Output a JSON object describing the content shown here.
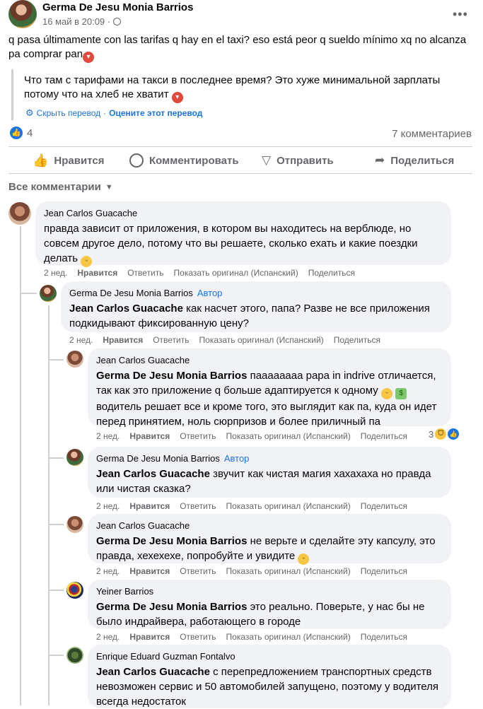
{
  "post": {
    "author": "Germa De Jesu Monia Barrios",
    "time": "16 май в 20:09 ·",
    "original_text": "q pasa últimamente con las tarifas q hay en el taxi? eso está peor q sueldo mínimo xq no alcanza pa comprar pan",
    "translated_text": "Что там с тарифами на такси в последнее время? Это хуже минимальной зарплаты потому что на хлеб не хватит",
    "hide_translation": "Скрыть перевод",
    "rate_translation": "Оцените этот перевод",
    "separator": "·",
    "reactions_count": "4",
    "comments_count": "7 комментариев"
  },
  "toolbar": {
    "like": "Нравится",
    "comment": "Комментировать",
    "send": "Отправить",
    "share": "Поделиться"
  },
  "comments_filter": "Все комментарии",
  "comments": [
    {
      "name": "Jean Carlos Guacache",
      "author_badge": "",
      "mention": "",
      "text": "правда зависит от приложения, в котором вы находитесь на верблюде, но совсем другое дело, потому что вы решаете, сколько ехать и какие поездки делать",
      "age": "2 нед.",
      "like": "Нравится",
      "reply": "Ответить",
      "show_original": "Показать оригинал (Испанский)",
      "share": "Поделиться"
    },
    {
      "name": "Germa De Jesu Monia Barrios",
      "author_badge": "Автор",
      "mention": "Jean Carlos Guacache",
      "text": "как насчет этого, папа? Разве не все приложения подкидывают фиксированную цену?",
      "age": "2 нед.",
      "like": "Нравится",
      "reply": "Ответить",
      "show_original": "Показать оригинал (Испанский)",
      "share": "Поделиться"
    },
    {
      "name": "Jean Carlos Guacache",
      "author_badge": "",
      "mention": "Germa De Jesu Monia Barrios",
      "text": "паааааааа papa in indrive отличается, так как это приложение q больше адаптируется к одному",
      "text2": "водитель решает все и кроме того, это выглядит как па, куда он идет перед принятием, ноль сюрпризов и более приличный па",
      "age": "2 нед.",
      "like": "Нравится",
      "reply": "Ответить",
      "show_original": "Показать оригинал (Испанский)",
      "share": "Поделиться",
      "reactions": "3"
    },
    {
      "name": "Germa De Jesu Monia Barrios",
      "author_badge": "Автор",
      "mention": "Jean Carlos Guacache",
      "text": "звучит как чистая магия хахахаха но правда или чистая сказка?",
      "age": "2 нед.",
      "like": "Нравится",
      "reply": "Ответить",
      "show_original": "Показать оригинал (Испанский)",
      "share": "Поделиться"
    },
    {
      "name": "Jean Carlos Guacache",
      "author_badge": "",
      "mention": "Germa De Jesu Monia Barrios",
      "text": "не верьте и сделайте эту капсулу, это правда, хехехехе, попробуйте и увидите",
      "age": "2 нед.",
      "like": "Нравится",
      "reply": "Ответить",
      "show_original": "Показать оригинал (Испанский)",
      "share": "Поделиться"
    },
    {
      "name": "Yeiner Barrios",
      "author_badge": "",
      "mention": "Germa De Jesu Monia Barrios",
      "text": "это реально. Поверьте, у нас бы не было индрайвера, работающего в городе",
      "age": "2 нед.",
      "like": "Нравится",
      "reply": "Ответить",
      "show_original": "Показать оригинал (Испанский)",
      "share": "Поделиться"
    },
    {
      "name": "Enrique Eduard Guzman Fontalvo",
      "author_badge": "",
      "mention": "Jean Carlos Guacache",
      "text": "с перепредложением транспортных средств невозможен сервис и 50 автомобилей запущено, поэтому у водителя всегда недостаток"
    }
  ],
  "colors": {
    "link": "#1b74e4",
    "bubble": "#f0f2f5",
    "meta": "#65676b"
  }
}
